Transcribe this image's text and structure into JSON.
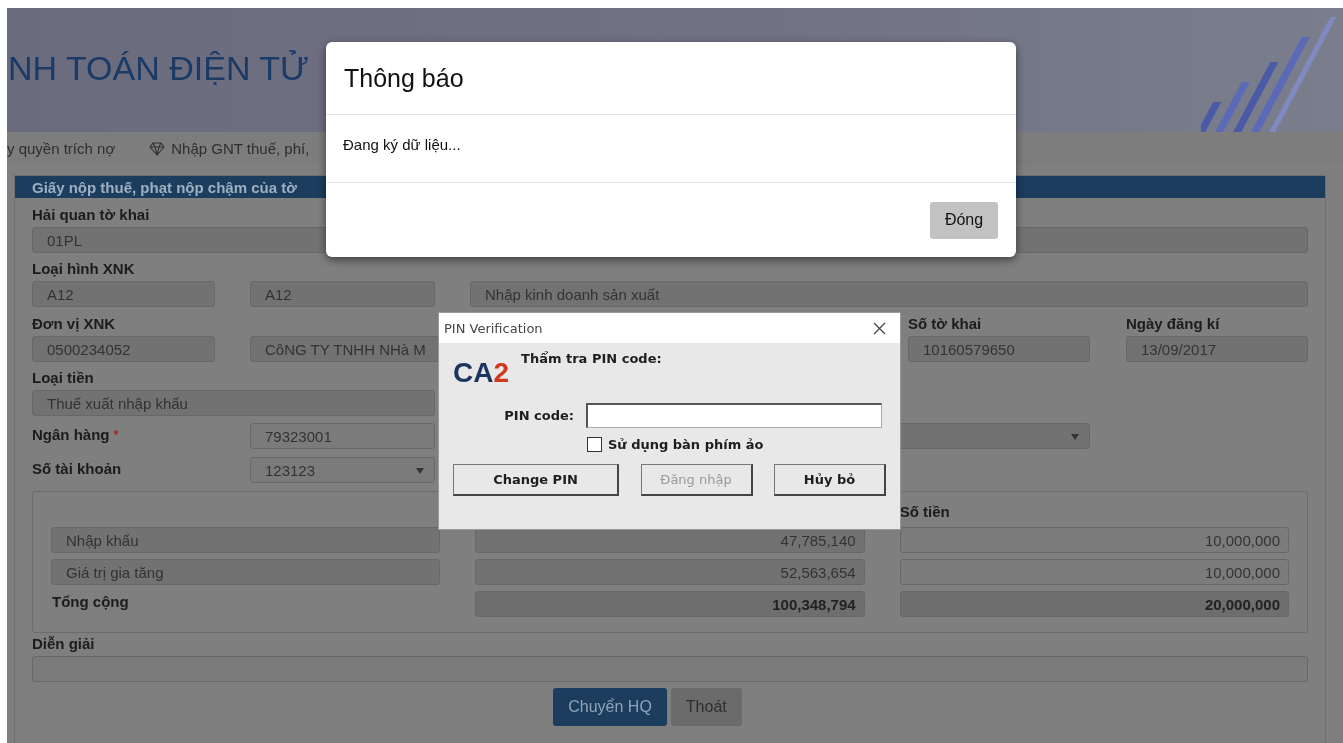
{
  "header": {
    "title": "NH TOÁN ĐIỆN TỬ"
  },
  "nav": [
    {
      "label": "y quyền trích nợ",
      "kind": "plain"
    },
    {
      "label": "Nhập GNT thuế, phí,",
      "kind": "diamond"
    }
  ],
  "form": {
    "title": "Giấy nộp thuế, phạt nộp chậm của tờ",
    "customs_office": {
      "label": "Hải quan tờ khai",
      "value": "01PL"
    },
    "import_export_type": {
      "label": "Loại hình XNK",
      "values": [
        "A12",
        "A12",
        "Nhập kinh doanh sản xuất"
      ]
    },
    "trader": {
      "label": "Đơn vị XNK",
      "values": [
        "0500234052",
        "CôNG TY TNHH NHà M"
      ]
    },
    "declaration_no": {
      "label": "Số tờ khai",
      "value": "10160579650"
    },
    "registration_date": {
      "label": "Ngày đăng kí",
      "value": "13/09/2017"
    },
    "currency_type": {
      "label": "Loại tiền",
      "value": "Thuế xuất nhập khẩu"
    },
    "bank": {
      "label": "Ngân hàng",
      "required_mark": "*",
      "value": "79323001"
    },
    "account": {
      "label": "Số tài khoản",
      "value": "123123"
    },
    "amounts": {
      "column_3": "Số tiền",
      "rows": [
        {
          "kind": "item",
          "name": "Nhập khẩu",
          "column_2": "47,785,140",
          "amount": "10,000,000"
        },
        {
          "kind": "item",
          "name": "Giá trị gia tăng",
          "column_2": "52,563,654",
          "amount": "10,000,000"
        },
        {
          "kind": "total",
          "name": "Tổng cộng",
          "column_2": "100,348,794",
          "amount": "20,000,000"
        }
      ]
    },
    "description": {
      "label": "Diễn giải"
    },
    "buttons": [
      {
        "label": "Chuyển HQ",
        "kind": "primary"
      },
      {
        "label": "Thoát",
        "kind": "default"
      }
    ]
  },
  "notice_dialog": {
    "title": "Thông báo",
    "message": "Đang ký dữ liệu...",
    "button": "Đóng"
  },
  "pin_dialog": {
    "title": "PIN Verification",
    "logo_letters": "CA",
    "logo_number": "2",
    "prompt": "Thẩm tra PIN code:",
    "pin_label": "PIN code:",
    "virtual_keyboard": {
      "label": "Sử dụng bàn phím ảo",
      "checked": false
    },
    "buttons": [
      {
        "label": "Change PIN",
        "disabled": false
      },
      {
        "label": "Đăng nhập",
        "disabled": true
      },
      {
        "label": "Hủy bỏ",
        "disabled": false
      }
    ]
  }
}
